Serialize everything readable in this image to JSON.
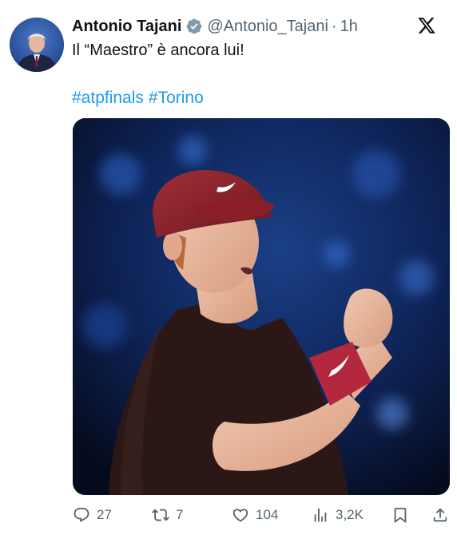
{
  "author": {
    "name": "Antonio Tajani",
    "handle": "@Antonio_Tajani",
    "separator": "·",
    "time": "1h"
  },
  "tweet": {
    "text": "Il “Maestro” è ancora lui!",
    "hashtags": [
      "#atpfinals",
      "#Torino"
    ]
  },
  "actions": {
    "replies": "27",
    "reposts": "7",
    "likes": "104",
    "views": "3,2K"
  },
  "colors": {
    "link": "#1d9bf0",
    "secondary_text": "#536471",
    "verified_badge": "#829aab"
  },
  "icons": [
    "verified-badge-icon",
    "x-logo-icon",
    "reply-icon",
    "repost-icon",
    "like-icon",
    "views-icon",
    "bookmark-icon",
    "share-icon"
  ]
}
